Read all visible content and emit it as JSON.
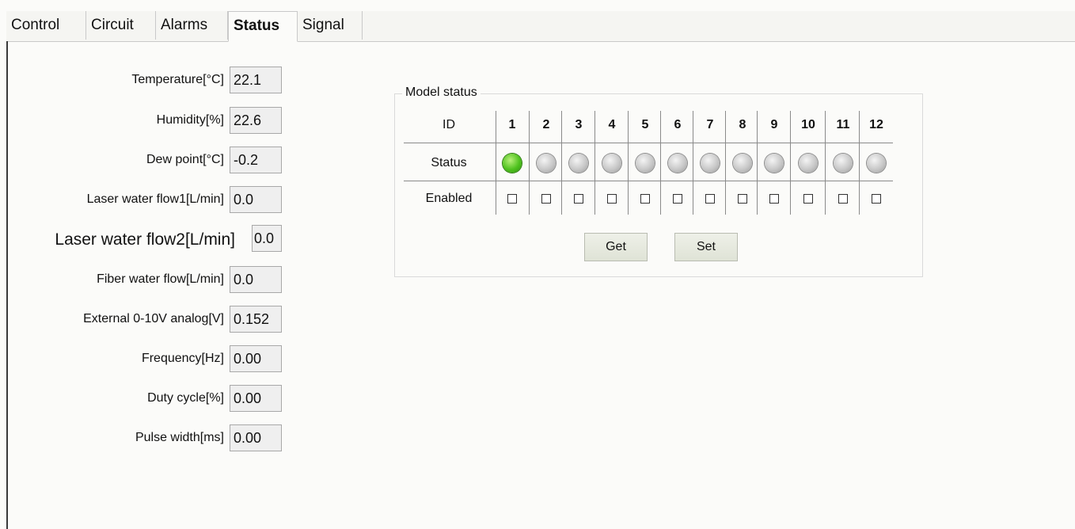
{
  "tabs": [
    {
      "label": "Control"
    },
    {
      "label": "Circuit"
    },
    {
      "label": "Alarms"
    },
    {
      "label": "Status"
    },
    {
      "label": "Signal"
    }
  ],
  "fields": [
    {
      "label": "Temperature[°C]",
      "value": "22.1"
    },
    {
      "label": "Humidity[%]",
      "value": "22.6"
    },
    {
      "label": "Dew point[°C]",
      "value": "-0.2"
    },
    {
      "label": "Laser water flow1[L/min]",
      "value": "0.0"
    },
    {
      "label": "Laser water flow2[L/min]",
      "value": "0.0"
    },
    {
      "label": "Fiber water flow[L/min]",
      "value": "0.0"
    },
    {
      "label": "External 0-10V analog[V]",
      "value": "0.152"
    },
    {
      "label": "Frequency[Hz]",
      "value": "0.00"
    },
    {
      "label": "Duty cycle[%]",
      "value": "0.00"
    },
    {
      "label": "Pulse width[ms]",
      "value": "0.00"
    }
  ],
  "model_status": {
    "title": "Model status",
    "id_label": "ID",
    "status_label": "Status",
    "enabled_label": "Enabled",
    "ids": [
      "1",
      "2",
      "3",
      "4",
      "5",
      "6",
      "7",
      "8",
      "9",
      "10",
      "11",
      "12"
    ],
    "status_on": [
      true,
      false,
      false,
      false,
      false,
      false,
      false,
      false,
      false,
      false,
      false,
      false
    ],
    "enabled": [
      false,
      false,
      false,
      false,
      false,
      false,
      false,
      false,
      false,
      false,
      false,
      false
    ],
    "get_label": "Get",
    "set_label": "Set"
  },
  "colors": {
    "led_on": "#4fc21e",
    "led_off": "#c8c8c8"
  }
}
